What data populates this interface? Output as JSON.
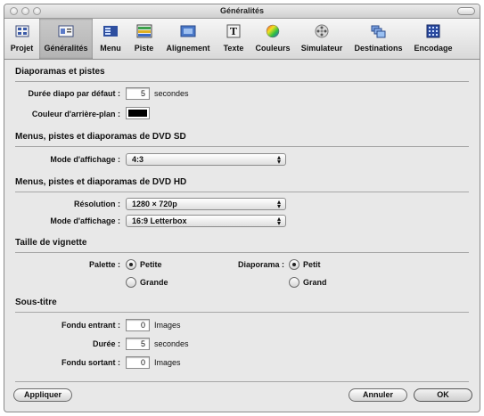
{
  "window": {
    "title": "Généralités"
  },
  "toolbar": {
    "items": [
      {
        "label": "Projet",
        "icon": "project-icon"
      },
      {
        "label": "Généralités",
        "icon": "general-icon",
        "selected": true
      },
      {
        "label": "Menu",
        "icon": "menu-icon"
      },
      {
        "label": "Piste",
        "icon": "track-icon"
      },
      {
        "label": "Alignement",
        "icon": "alignment-icon"
      },
      {
        "label": "Texte",
        "icon": "text-icon"
      },
      {
        "label": "Couleurs",
        "icon": "colors-icon"
      },
      {
        "label": "Simulateur",
        "icon": "simulator-icon"
      },
      {
        "label": "Destinations",
        "icon": "destinations-icon"
      },
      {
        "label": "Encodage",
        "icon": "encoding-icon"
      }
    ]
  },
  "slideshows": {
    "heading": "Diaporamas et pistes",
    "duration_label": "Durée diapo par défaut :",
    "duration_value": "5",
    "duration_unit": "secondes",
    "bgcolor_label": "Couleur d'arrière-plan :",
    "bgcolor": "#000000"
  },
  "sd": {
    "heading": "Menus, pistes et diaporamas de DVD SD",
    "display_label": "Mode d'affichage :",
    "display_value": "4:3"
  },
  "hd": {
    "heading": "Menus, pistes et diaporamas de DVD HD",
    "resolution_label": "Résolution :",
    "resolution_value": "1280 × 720p",
    "display_label": "Mode d'affichage :",
    "display_value": "16:9 Letterbox"
  },
  "thumbnail": {
    "heading": "Taille de vignette",
    "palette_label": "Palette :",
    "palette_small": "Petite",
    "palette_large": "Grande",
    "palette_selected": "Petite",
    "slideshow_label": "Diaporama :",
    "slideshow_small": "Petit",
    "slideshow_large": "Grand",
    "slideshow_selected": "Petit"
  },
  "subtitle": {
    "heading": "Sous-titre",
    "fadein_label": "Fondu entrant :",
    "fadein_value": "0",
    "fadein_unit": "Images",
    "duration_label": "Durée :",
    "duration_value": "5",
    "duration_unit": "secondes",
    "fadeout_label": "Fondu sortant :",
    "fadeout_value": "0",
    "fadeout_unit": "Images"
  },
  "buttons": {
    "apply": "Appliquer",
    "cancel": "Annuler",
    "ok": "OK"
  },
  "colors": {
    "window_bg": "#e8e8e8",
    "selected_tool": "#b8b8b8"
  }
}
